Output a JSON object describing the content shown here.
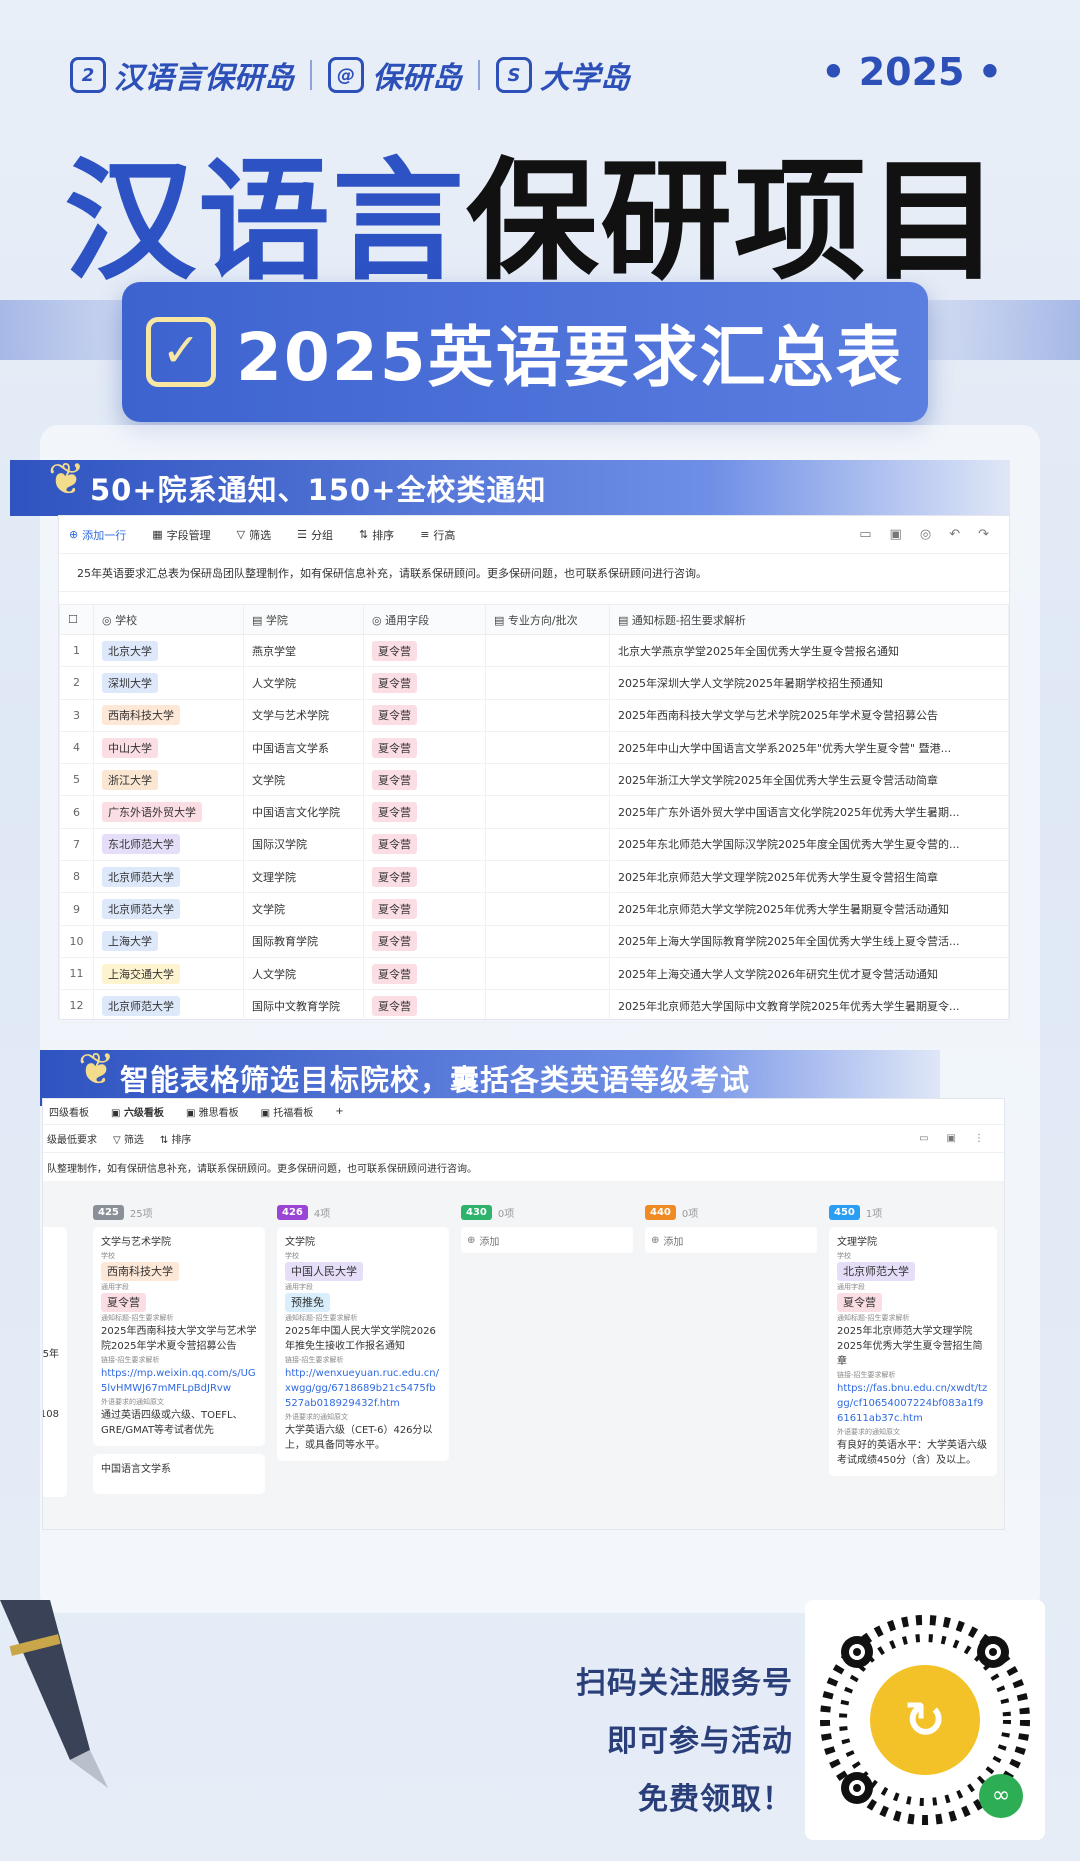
{
  "brands": [
    "汉语言保研岛",
    "保研岛",
    "大学岛"
  ],
  "year": "• 2025 •",
  "title_blue": "汉语言",
  "title_dark": "保研项目",
  "banner_text": "2025英语要求汇总表",
  "ribbon1": "50+院系通知、150+全校类通知",
  "ribbon2": "智能表格筛选目标院校，囊括各类英语等级考试",
  "table_toolbar": [
    "添加一行",
    "字段管理",
    "筛选",
    "分组",
    "排序",
    "行高"
  ],
  "table_note": "25年英语要求汇总表为保研岛团队整理制作，如有保研信息补充，请联系保研顾问。更多保研问题，也可联系保研顾问进行咨询。",
  "table_headers": [
    "学校",
    "学院",
    "通用字段",
    "专业方向/批次",
    "通知标题-招生要求解析"
  ],
  "rows": [
    {
      "n": "1",
      "school": "北京大学",
      "college": "燕京学堂",
      "type": "夏令营",
      "title": "北京大学燕京学堂2025年全国优秀大学生夏令营报名通知"
    },
    {
      "n": "2",
      "school": "深圳大学",
      "college": "人文学院",
      "type": "夏令营",
      "title": "2025年深圳大学人文学院2025年暑期学校招生预通知"
    },
    {
      "n": "3",
      "school": "西南科技大学",
      "college": "文学与艺术学院",
      "type": "夏令营",
      "title": "2025年西南科技大学文学与艺术学院2025年学术夏令营招募公告"
    },
    {
      "n": "4",
      "school": "中山大学",
      "college": "中国语言文学系",
      "type": "夏令营",
      "title": "2025年中山大学中国语言文学系2025年\"优秀大学生夏令营\" 暨港..."
    },
    {
      "n": "5",
      "school": "浙江大学",
      "college": "文学院",
      "type": "夏令营",
      "title": "2025年浙江大学文学院2025年全国优秀大学生云夏令营活动简章"
    },
    {
      "n": "6",
      "school": "广东外语外贸大学",
      "college": "中国语言文化学院",
      "type": "夏令营",
      "title": "2025年广东外语外贸大学中国语言文化学院2025年优秀大学生暑期..."
    },
    {
      "n": "7",
      "school": "东北师范大学",
      "college": "国际汉学院",
      "type": "夏令营",
      "title": "2025年东北师范大学国际汉学院2025年度全国优秀大学生夏令营的..."
    },
    {
      "n": "8",
      "school": "北京师范大学",
      "college": "文理学院",
      "type": "夏令营",
      "title": "2025年北京师范大学文理学院2025年优秀大学生夏令营招生简章"
    },
    {
      "n": "9",
      "school": "北京师范大学",
      "college": "文学院",
      "type": "夏令营",
      "title": "2025年北京师范大学文学院2025年优秀大学生暑期夏令营活动通知"
    },
    {
      "n": "10",
      "school": "上海大学",
      "college": "国际教育学院",
      "type": "夏令营",
      "title": "2025年上海大学国际教育学院2025年全国优秀大学生线上夏令营活..."
    },
    {
      "n": "11",
      "school": "上海交通大学",
      "college": "人文学院",
      "type": "夏令营",
      "title": "2025年上海交通大学人文学院2026年研究生优才夏令营活动通知"
    },
    {
      "n": "12",
      "school": "北京师范大学",
      "college": "国际中文教育学院",
      "type": "夏令营",
      "title": "2025年北京师范大学国际中文教育学院2025年优秀大学生暑期夏令..."
    }
  ],
  "school_colors": [
    "#dde8fb",
    "#dde8fb",
    "#fde7d6",
    "#fbdde4",
    "#fbe6d2",
    "#fbdde4",
    "#e6def9",
    "#dde8fb",
    "#dde8fb",
    "#dde8fb",
    "#fdf3cf",
    "#dde8fb"
  ],
  "kanban_tabs": [
    "四级看板",
    "六级看板",
    "雅思看板",
    "托福看板",
    "+"
  ],
  "kanban_tool": [
    "级最低要求",
    "筛选",
    "排序"
  ],
  "kanban_note": "队整理制作，如有保研信息补充，请联系保研顾问。更多保研问题，也可联系保研顾问进行咨询。",
  "kanban_cols": [
    {
      "badge": "425",
      "color": "#8a8f98",
      "count": "25项"
    },
    {
      "badge": "426",
      "color": "#9a45d6",
      "count": "4项"
    },
    {
      "badge": "430",
      "color": "#2db36b",
      "count": "0项"
    },
    {
      "badge": "440",
      "color": "#f08a24",
      "count": "0项"
    },
    {
      "badge": "450",
      "color": "#2a9df4",
      "count": "1项"
    }
  ],
  "kanban_add": "添加",
  "kanban_left_stub": [
    "5年",
    "108"
  ],
  "kanban_lbl": {
    "school": "学校",
    "type": "通用字段",
    "notice": "通知标题-招生要求解析",
    "link": "链接-招生要求解析",
    "req": "外语要求的通知原文"
  },
  "card1": {
    "college": "文学与艺术学院",
    "school": "西南科技大学",
    "type": "夏令营",
    "notice": "2025年西南科技大学文学与艺术学院2025年学术夏令营招募公告",
    "link": "https://mp.weixin.qq.com/s/UG5lvHMWJ67mMFLpBdJRvw",
    "req": "通过英语四级或六级、TOEFL、GRE/GMAT等考试者优先",
    "next": "中国语言文学系"
  },
  "card2": {
    "college": "文学院",
    "school": "中国人民大学",
    "type": "预推免",
    "notice": "2025年中国人民大学文学院2026年推免生接收工作报名通知",
    "link": "http://wenxueyuan.ruc.edu.cn/xwgg/gg/6718689b21c5475fb527ab018929432f.htm",
    "req": "大学英语六级（CET-6）426分以上，或具备同等水平。"
  },
  "card3": {
    "college": "文理学院",
    "school": "北京师范大学",
    "type": "夏令营",
    "notice": "2025年北京师范大学文理学院2025年优秀大学生夏令营招生简章",
    "link": "https://fas.bnu.edu.cn/xwdt/tzgg/cf10654007224bf083a1f961611ab37c.htm",
    "req": "有良好的英语水平：大学英语六级考试成绩450分（含）及以上。"
  },
  "cta": [
    "扫码关注服务号",
    "即可参与活动",
    "免费领取！"
  ]
}
